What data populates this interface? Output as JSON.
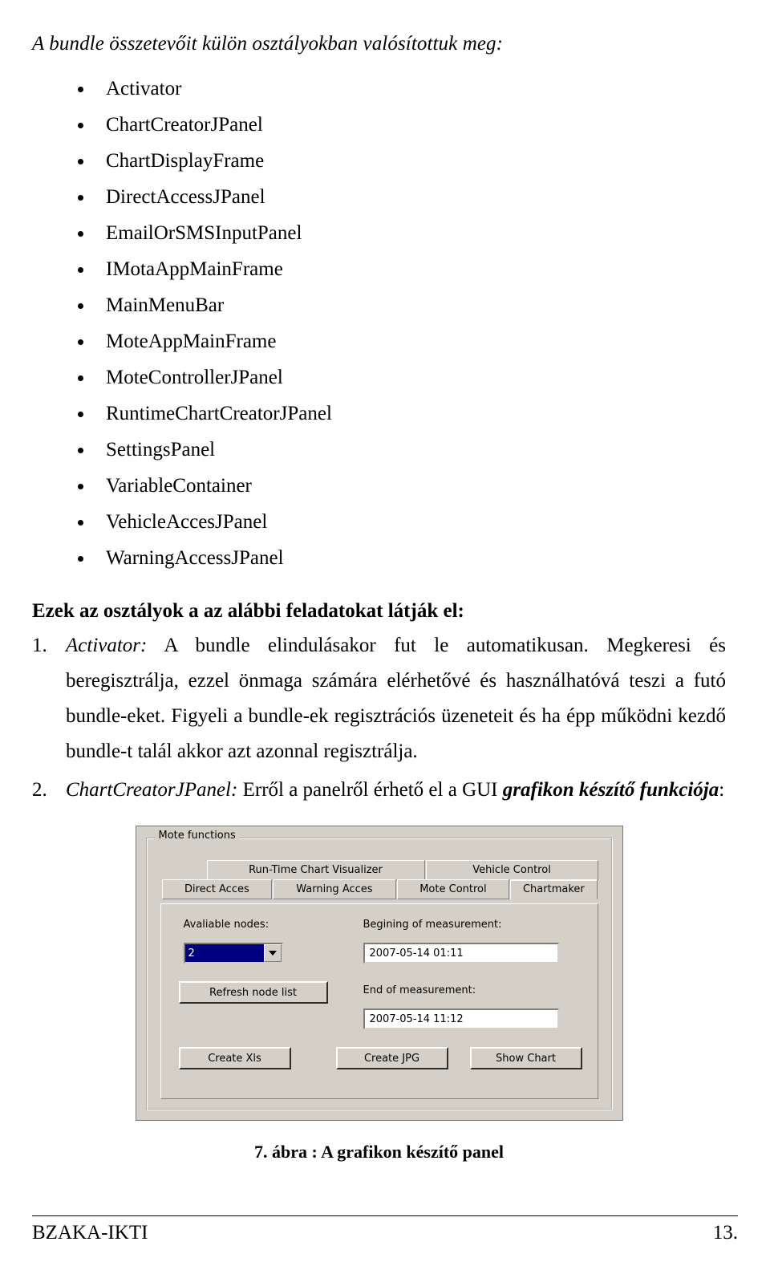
{
  "document": {
    "intro_line": "A bundle összetevőit külön osztályokban valósítottuk meg:",
    "class_list": [
      "Activator",
      "ChartCreatorJPanel",
      "ChartDisplayFrame",
      "DirectAccessJPanel",
      "EmailOrSMSInputPanel",
      "IMotaAppMainFrame",
      "MainMenuBar",
      "MoteAppMainFrame",
      "MoteControllerJPanel",
      "RuntimeChartCreatorJPanel",
      "SettingsPanel",
      "VariableContainer",
      "VehicleAccesJPanel",
      "WarningAccessJPanel"
    ],
    "tasks_heading": "Ezek az osztályok a az alábbi feladatokat látják el:",
    "items": [
      {
        "number": "1.",
        "title": "Activator:",
        "body": " A bundle elindulásakor fut le automatikusan. Megkeresi és beregisztrálja, ezzel önmaga számára elérhetővé és használhatóvá teszi a futó bundle-eket. Figyeli a bundle-ek regisztrációs üzeneteit és ha épp működni kezdő bundle-t talál akkor azt azonnal regisztrálja."
      },
      {
        "number": "2.",
        "title": "ChartCreatorJPanel:",
        "body_pre": " Erről a panelről érhető el a GUI ",
        "body_bold_italic": "grafikon készítő funkciója",
        "body_post": ":"
      }
    ],
    "figure_caption": "7. ábra : A grafikon készítő panel",
    "footer": {
      "left": "BZAKA-IKTI",
      "right": "13."
    }
  },
  "screenshot": {
    "group_title": "Mote functions",
    "tabs_top": [
      "Run-Time Chart Visualizer",
      "Vehicle Control"
    ],
    "tabs_bottom": [
      "Direct Acces",
      "Warning Acces",
      "Mote Control",
      "Chartmaker"
    ],
    "selected_tab": "Chartmaker",
    "labels": {
      "available_nodes": "Avaliable nodes:",
      "begining": "Begining of measurement:",
      "end": "End of measurement:"
    },
    "node_combo_value": "2",
    "begin_value": "2007-05-14 01:11",
    "end_value": "2007-05-14 11:12",
    "buttons": {
      "refresh": "Refresh node list",
      "create_xls": "Create Xls",
      "create_jpg": "Create JPG",
      "show_chart": "Show Chart"
    }
  }
}
